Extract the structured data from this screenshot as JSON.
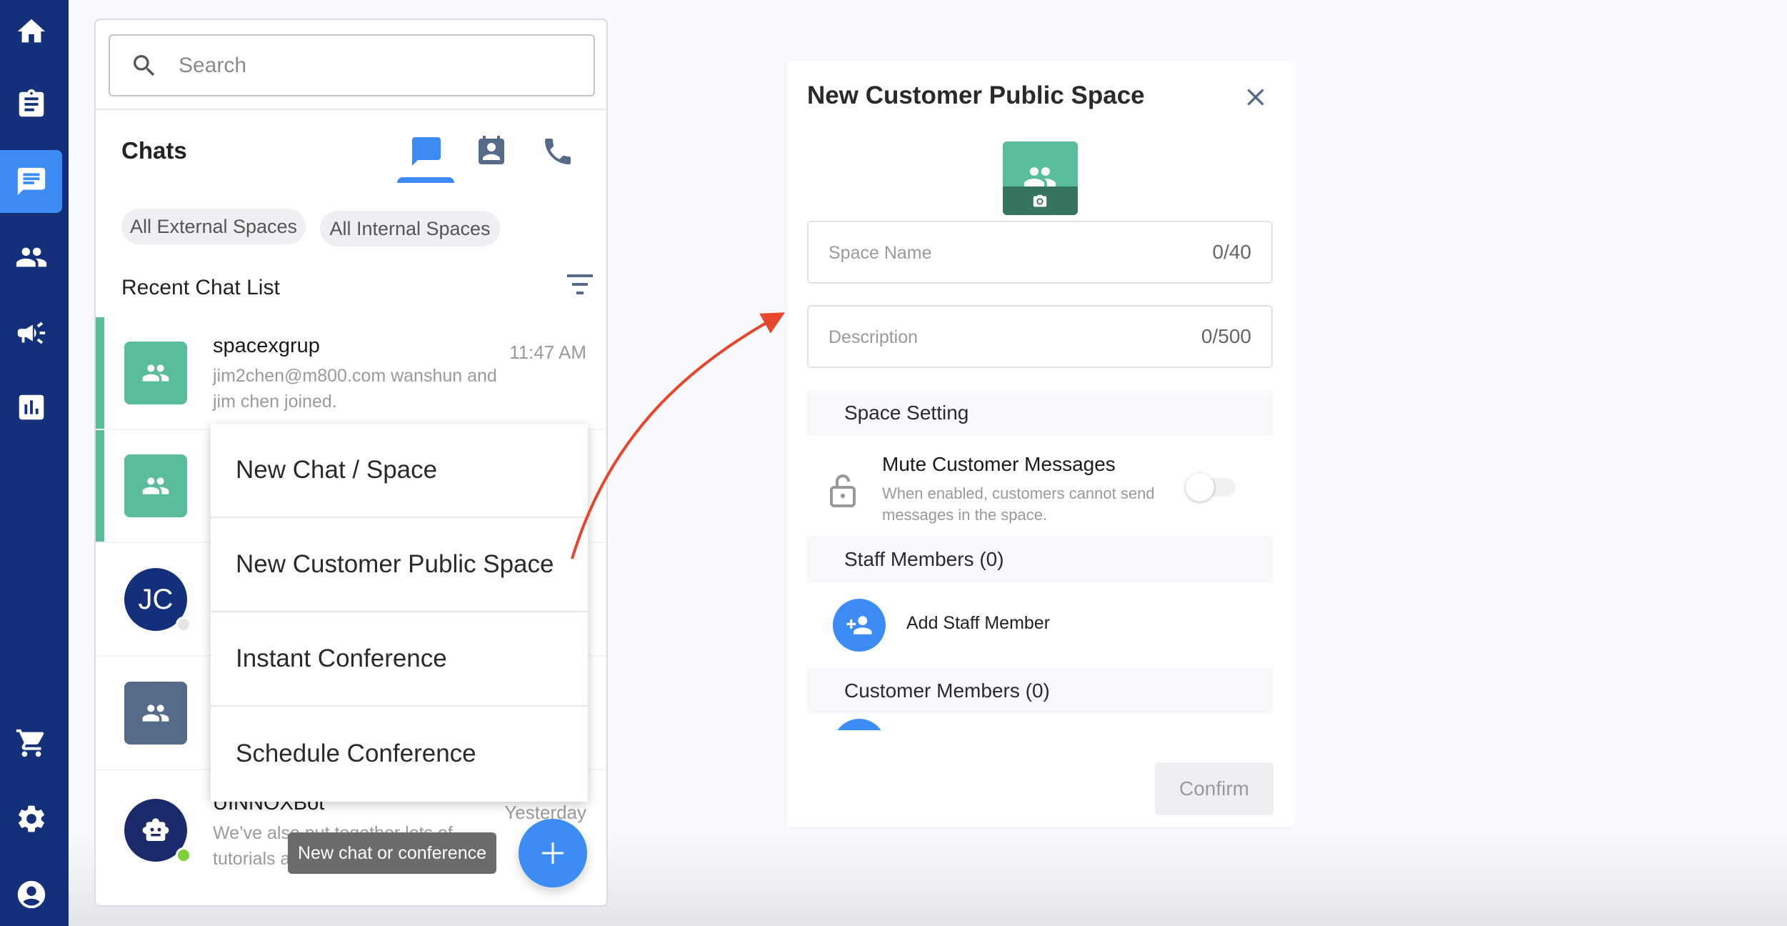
{
  "sidebar": {
    "items": [
      {
        "icon": "home-icon",
        "label": "Home"
      },
      {
        "icon": "clipboard-icon",
        "label": "Tasks"
      },
      {
        "icon": "chat-icon",
        "label": "Chats",
        "active": true
      },
      {
        "icon": "contacts-icon",
        "label": "Contacts"
      },
      {
        "icon": "megaphone-icon",
        "label": "Campaigns"
      },
      {
        "icon": "bar-chart-icon",
        "label": "Reports"
      },
      {
        "icon": "cart-icon",
        "label": "Store"
      },
      {
        "icon": "gear-icon",
        "label": "Settings"
      },
      {
        "icon": "account-icon",
        "label": "Account"
      }
    ]
  },
  "chat_panel": {
    "search": {
      "placeholder": "Search",
      "value": ""
    },
    "title": "Chats",
    "tabs": [
      {
        "icon": "chat-bubble-icon",
        "active": true
      },
      {
        "icon": "contact-book-icon",
        "active": false
      },
      {
        "icon": "phone-icon",
        "active": false
      }
    ],
    "chips": [
      "All External Spaces",
      "All Internal Spaces"
    ],
    "recent_label": "Recent Chat List",
    "chats": [
      {
        "name": "spacexgrup",
        "preview": "jim2chen@m800.com wanshun and jim chen joined.",
        "time": "11:47 AM",
        "avatar": "group",
        "avatar_color": "#58bd98",
        "accent": true
      },
      {
        "name": "",
        "preview": "",
        "time": "",
        "avatar": "group",
        "avatar_color": "#58bd98",
        "accent": true
      },
      {
        "name": "",
        "preview": "",
        "time": "",
        "avatar": "initials",
        "initials": "JC",
        "avatar_color": "#14307a",
        "presence": "offline"
      },
      {
        "name": "",
        "preview": "",
        "time": "",
        "avatar": "group",
        "avatar_color": "#566a8a"
      },
      {
        "name": "UINNOXBot",
        "preview": "We’ve also put together lots of tutorials and advanced tips and tricks...",
        "time": "Yesterday",
        "avatar": "bot",
        "avatar_color": "#1b2a6b",
        "presence": "online"
      }
    ]
  },
  "popup_menu": {
    "items": [
      "New Chat / Space",
      "New Customer Public Space",
      "Instant Conference",
      "Schedule Conference"
    ]
  },
  "tooltip": "New chat or conference",
  "fab": {
    "icon": "plus-icon"
  },
  "dialog": {
    "title": "New Customer Public Space",
    "space_name": {
      "placeholder": "Space Name",
      "value": "",
      "counter": "0/40"
    },
    "description": {
      "placeholder": "Description",
      "value": "",
      "counter": "0/500"
    },
    "space_setting_header": "Space Setting",
    "mute": {
      "title": "Mute Customer Messages",
      "description": "When enabled, customers cannot send messages in the space.",
      "enabled": false
    },
    "staff_header": "Staff Members (0)",
    "add_staff_label": "Add Staff Member",
    "customer_header": "Customer Members (0)",
    "confirm_label": "Confirm"
  },
  "colors": {
    "sidebar": "#14307a",
    "accent_blue": "#3d8bf5",
    "group_green": "#58bd98",
    "annotation_arrow": "#e8452a"
  }
}
